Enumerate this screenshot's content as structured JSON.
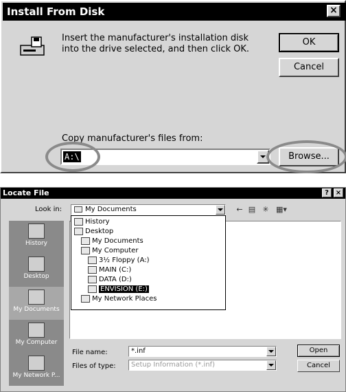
{
  "install_dialog": {
    "title": "Install From Disk",
    "close_glyph": "×",
    "message": "Insert the manufacturer's installation disk into the drive selected, and then click OK.",
    "ok_label": "OK",
    "cancel_label": "Cancel",
    "copy_label": "Copy manufacturer's files from:",
    "path_value": "A:\\",
    "browse_label": "Browse..."
  },
  "locate_dialog": {
    "title": "Locate File",
    "help_glyph": "?",
    "close_glyph": "×",
    "look_in_label": "Look in:",
    "look_in_value": "My Documents",
    "toolbar_icons": [
      "back-icon",
      "up-folder-icon",
      "new-folder-icon",
      "view-menu-icon"
    ],
    "places": [
      {
        "label": "History",
        "icon": "history-icon"
      },
      {
        "label": "Desktop",
        "icon": "desktop-icon"
      },
      {
        "label": "My Documents",
        "icon": "my-documents-icon"
      },
      {
        "label": "My Computer",
        "icon": "my-computer-icon"
      },
      {
        "label": "My Network P...",
        "icon": "network-places-icon"
      }
    ],
    "dropdown_items": [
      {
        "label": "History",
        "indent": 0
      },
      {
        "label": "Desktop",
        "indent": 0
      },
      {
        "label": "My Documents",
        "indent": 1
      },
      {
        "label": "My Computer",
        "indent": 1
      },
      {
        "label": "3½ Floppy (A:)",
        "indent": 2
      },
      {
        "label": "MAIN (C:)",
        "indent": 2
      },
      {
        "label": "DATA (D:)",
        "indent": 2
      },
      {
        "label": "ENVISION (E:)",
        "indent": 2,
        "selected": true
      },
      {
        "label": "My Network Places",
        "indent": 1
      }
    ],
    "file_name_label": "File name:",
    "file_name_value": "*.inf",
    "file_type_label": "Files of type:",
    "file_type_value": "Setup Information (*.inf)",
    "open_label": "Open",
    "cancel_label": "Cancel"
  }
}
